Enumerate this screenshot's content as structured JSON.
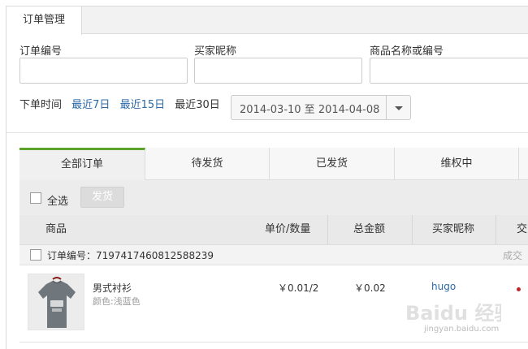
{
  "top_tab": {
    "label": "订单管理"
  },
  "filters": {
    "order_no_label": "订单编号",
    "buyer_label": "买家昵称",
    "product_label": "商品名称或编号",
    "order_no_value": "",
    "buyer_value": "",
    "product_value": ""
  },
  "time_filter": {
    "label": "下单时间",
    "opt1": "最近7日",
    "opt2": "最近15日",
    "opt3": "最近30日",
    "range": "2014-03-10 至 2014-04-08"
  },
  "order_tabs": [
    "全部订单",
    "待发货",
    "已发货",
    "维权中"
  ],
  "toolbar": {
    "select_all": "全选",
    "ship_button": "发货"
  },
  "columns": {
    "product": "商品",
    "price_qty": "单价/数量",
    "total": "总金额",
    "buyer": "买家昵称",
    "status_cut": "交"
  },
  "order": {
    "number_text": "订单编号：7197417460812588239",
    "deal_cut": "成交",
    "product_name": "男式衬衫",
    "color": "颜色:浅蓝色",
    "price_qty": "￥0.01/2",
    "total": "￥0.02",
    "buyer": "hugo"
  },
  "watermark": {
    "brand": "Baidu 经验",
    "url": "jingyan.baidu.com"
  },
  "colors": {
    "accent_green": "#5ba32b",
    "link_blue": "#2d6aa8",
    "status_red": "#c0262a"
  }
}
